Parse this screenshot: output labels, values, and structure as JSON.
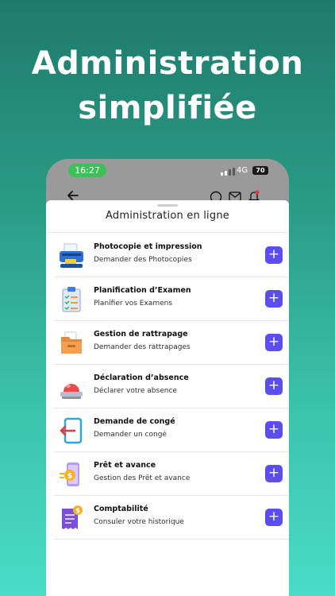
{
  "headline": {
    "line1": "Administration",
    "line2": "simplifiée"
  },
  "status_bar": {
    "time": "16:27",
    "network": "4G",
    "battery": "70"
  },
  "sheet": {
    "title": "Administration en ligne"
  },
  "items": [
    {
      "label": "Photocopie et impression",
      "sub": "Demander des Photocopies",
      "icon": "printer-icon"
    },
    {
      "label": "Planification d’Examen",
      "sub": "Planifier vos Examens",
      "icon": "clipboard-icon"
    },
    {
      "label": "Gestion de rattrapage",
      "sub": "Demander des rattrapages",
      "icon": "folder-icon"
    },
    {
      "label": "Déclaration d’absence",
      "sub": "Déclarer votre absence",
      "icon": "alarm-light-icon"
    },
    {
      "label": "Demande de congé",
      "sub": "Demander un congé",
      "icon": "exit-door-icon"
    },
    {
      "label": "Prêt et avance",
      "sub": "Gestion des Prêt et avance",
      "icon": "money-phone-icon"
    },
    {
      "label": "Comptabilité",
      "sub": "Consuler votre historique",
      "icon": "invoice-icon"
    }
  ],
  "add_symbol": "+",
  "colors": {
    "accent": "#5b4df0",
    "bg_top": "#1f7a6b",
    "bg_bottom": "#49dcc6",
    "status_pill": "#3fbf5a"
  }
}
